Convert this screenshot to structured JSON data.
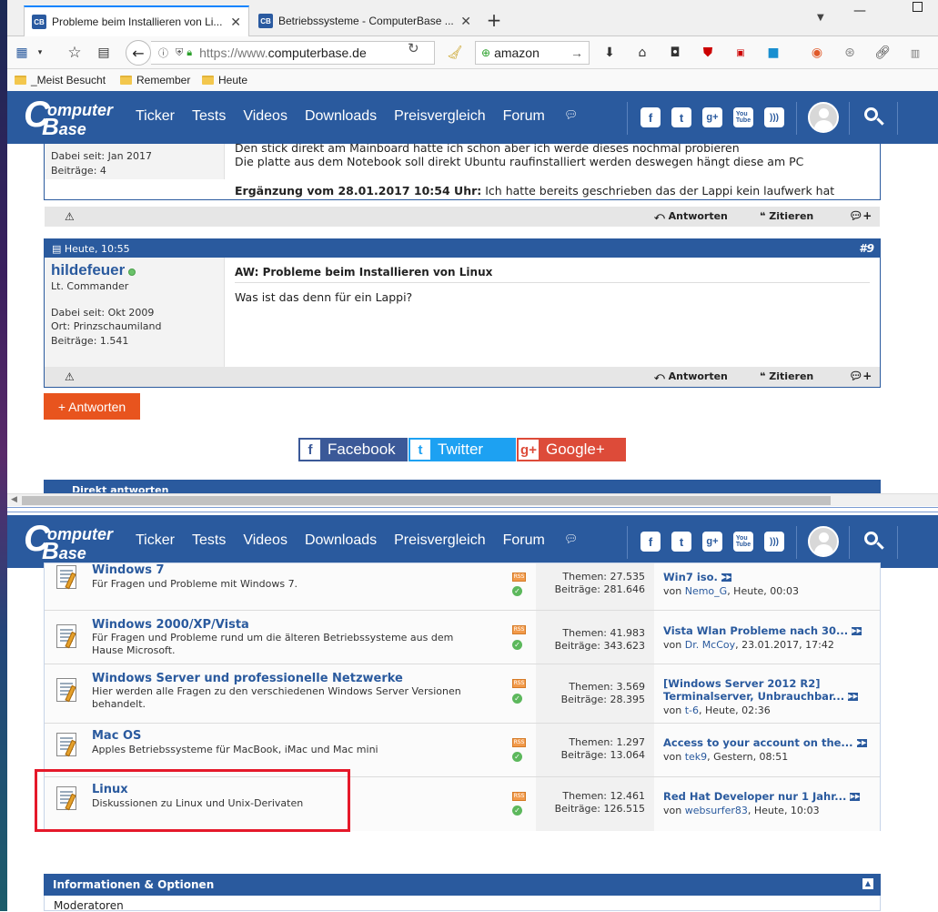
{
  "browser": {
    "tabs": [
      {
        "title": "Probleme beim Installieren von Li..."
      },
      {
        "title": "Betriebssysteme - ComputerBase ..."
      }
    ],
    "url_prefix": "https://www.",
    "url_domain": "computerbase.de",
    "search_value": "amazon",
    "bookmarks": [
      "_Meist Besucht",
      "Remember",
      "Heute"
    ]
  },
  "site": {
    "logo_c": "C",
    "logo_line1": "omputer",
    "logo_line2": "ase",
    "nav": [
      "Ticker",
      "Tests",
      "Videos",
      "Downloads",
      "Preisvergleich",
      "Forum"
    ],
    "social": [
      "f",
      "t",
      "g+",
      "You Tube",
      "rss"
    ]
  },
  "posts": {
    "prev": {
      "joined": "Dabei seit: Jan 2017",
      "count": "Beiträge: 4",
      "text_line1": "Den stick direkt am Mainboard hatte ich schon aber ich werde dieses nochmal probieren",
      "text_line2": "Die platte aus dem Notebook soll direkt Ubuntu raufinstalliert werden deswegen hängt diese am PC",
      "edit_label": "Ergänzung vom 28.01.2017 10:54 Uhr:",
      "edit_text": "Ich hatte bereits geschrieben das der Lappi kein laufwerk hat"
    },
    "current": {
      "date": "Heute, 10:55",
      "number": "#9",
      "username": "hildefeuer",
      "rank": "Lt. Commander",
      "joined": "Dabei seit: Okt 2009",
      "location": "Ort: Prinzschaumiland",
      "count": "Beiträge: 1.541",
      "subject": "AW: Probleme beim Installieren von Linux",
      "text": "Was ist das denn für ein Lappi?"
    },
    "actions": {
      "reply": "Antworten",
      "quote": "Zitieren"
    }
  },
  "reply_button": "+ Antworten",
  "share": {
    "facebook": "Facebook",
    "twitter": "Twitter",
    "google": "Google+"
  },
  "direct_reply": "Direkt antworten",
  "forums": [
    {
      "title": "Windows 7",
      "desc": "Für Fragen und Probleme mit Windows 7.",
      "themes": "Themen: 27.535",
      "posts": "Beiträge: 281.646",
      "last_title": "Win7 iso.",
      "last_title2": "",
      "last_user": "Nemo_G",
      "last_time": ", Heute, 00:03"
    },
    {
      "title": "Windows 2000/XP/Vista",
      "desc": "Für Fragen und Probleme rund um die älteren Betriebssysteme aus dem Hause Microsoft.",
      "themes": "Themen: 41.983",
      "posts": "Beiträge: 343.623",
      "last_title": "Vista Wlan Probleme nach 30...",
      "last_title2": "",
      "last_user": "Dr. McCoy",
      "last_time": ", 23.01.2017, 17:42"
    },
    {
      "title": "Windows Server und professionelle Netzwerke",
      "desc": "Hier werden alle Fragen zu den verschiedenen Windows Server Versionen behandelt.",
      "themes": "Themen: 3.569",
      "posts": "Beiträge: 28.395",
      "last_title": "[Windows Server 2012 R2]",
      "last_title2": "Terminalserver, Unbrauchbar...",
      "last_user": "t-6",
      "last_time": ", Heute, 02:36"
    },
    {
      "title": "Mac OS",
      "desc": "Apples Betriebssysteme für MacBook, iMac und Mac mini",
      "themes": "Themen: 1.297",
      "posts": "Beiträge: 13.064",
      "last_title": "Access to your account on the...",
      "last_title2": "",
      "last_user": "tek9",
      "last_time": ", Gestern, 08:51"
    },
    {
      "title": "Linux",
      "desc": "Diskussionen zu Linux und Unix-Derivaten",
      "themes": "Themen: 12.461",
      "posts": "Beiträge: 126.515",
      "last_title": "Red Hat Developer nur 1 Jahr...",
      "last_title2": "",
      "last_user": "websurfer83",
      "last_time": ", Heute, 10:03"
    }
  ],
  "by_prefix": "von ",
  "info": {
    "title": "Informationen & Optionen",
    "moderators": "Moderatoren"
  },
  "colors": {
    "brand_blue": "#2a5a9e",
    "reply_orange": "#e8541e",
    "highlight_red": "#e5192a"
  }
}
